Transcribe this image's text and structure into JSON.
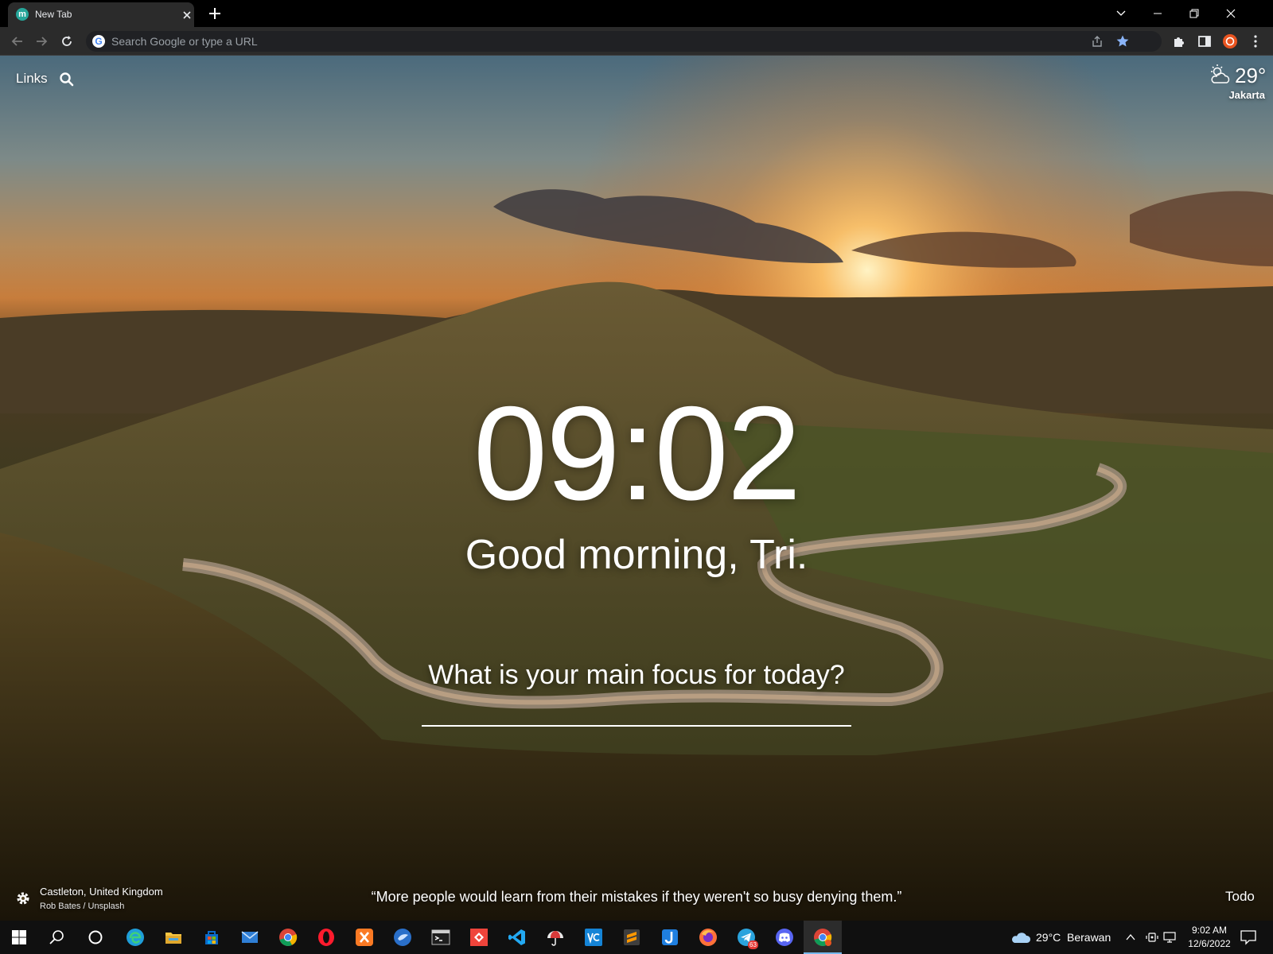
{
  "browser": {
    "tab_title": "New Tab",
    "omnibox_placeholder": "Search Google or type a URL"
  },
  "dashboard": {
    "links_label": "Links",
    "weather": {
      "temperature": "29°",
      "city": "Jakarta"
    },
    "clock": "09:02",
    "greeting": "Good morning, Tri.",
    "focus_prompt": "What is your main focus for today?",
    "photo": {
      "location": "Castleton, United Kingdom",
      "credit": "Rob Bates / Unsplash"
    },
    "quote": "“More people would learn from their mistakes if they weren't so busy denying them.”",
    "todo_label": "Todo"
  },
  "taskbar": {
    "weather_text": "29°C",
    "weather_desc": "Berawan",
    "time": "9:02 AM",
    "date": "12/6/2022",
    "telegram_badge": "63",
    "apps": [
      "edge-icon",
      "file-explorer-icon",
      "store-icon",
      "mail-icon",
      "chrome-icon",
      "opera-icon",
      "xampp-icon",
      "bluebird-icon",
      "terminal-icon",
      "anydesk-icon",
      "vscode-icon",
      "umbrella-app-icon",
      "vc-icon",
      "sublime-icon",
      "jdownloader-icon",
      "firefox-icon",
      "telegram-icon",
      "discord-icon",
      "chrome-active-icon"
    ]
  },
  "colors": {
    "tab_bg": "#2b2b2b",
    "toolbar_bg": "#2b2b2b",
    "accent_star": "#8ab4f8",
    "taskbar_bg": "#101010"
  }
}
